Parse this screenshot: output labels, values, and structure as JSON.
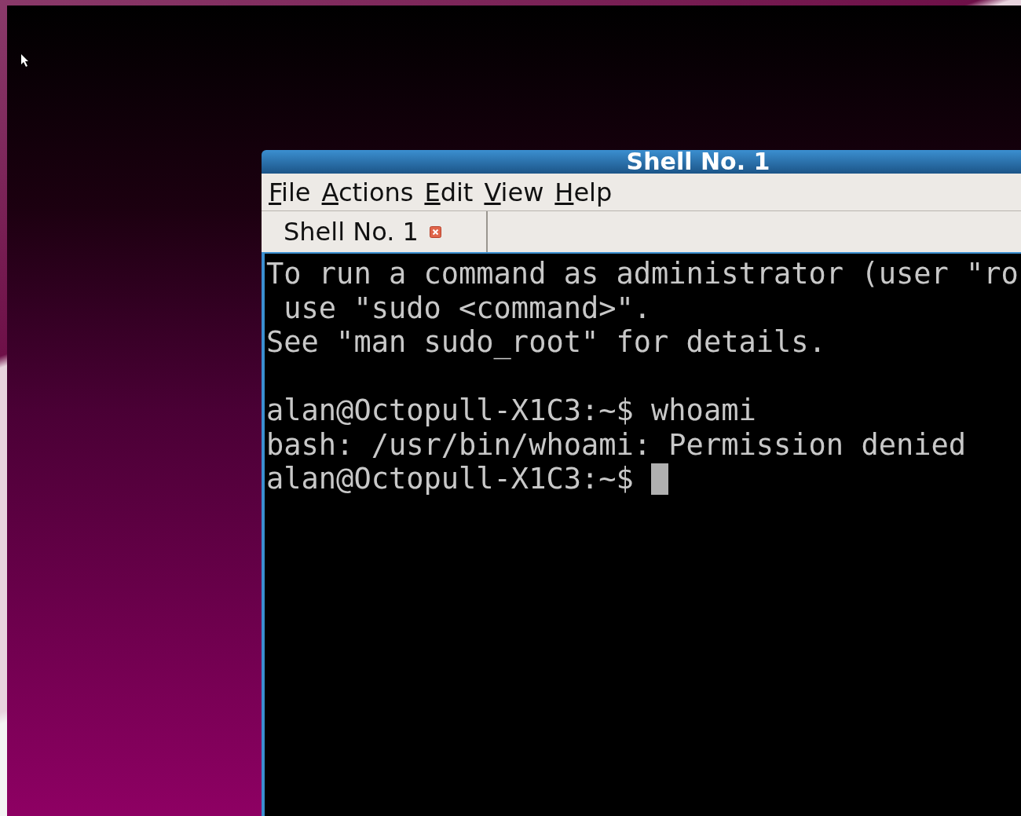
{
  "window": {
    "title": "Shell No. 1"
  },
  "menu": [
    "File",
    "Actions",
    "Edit",
    "View",
    "Help"
  ],
  "tabs": [
    {
      "label": "Shell No. 1",
      "selected": true
    }
  ],
  "terminal": {
    "blocks": [
      [
        "To run a command as administrator (user \"ro",
        " use \"sudo <command>\".",
        "See \"man sudo_root\" for details."
      ],
      [
        "alan@Octopull-X1C3:~$ whoami",
        "bash: /usr/bin/whoami: Permission denied",
        "alan@Octopull-X1C3:~$ "
      ]
    ]
  }
}
